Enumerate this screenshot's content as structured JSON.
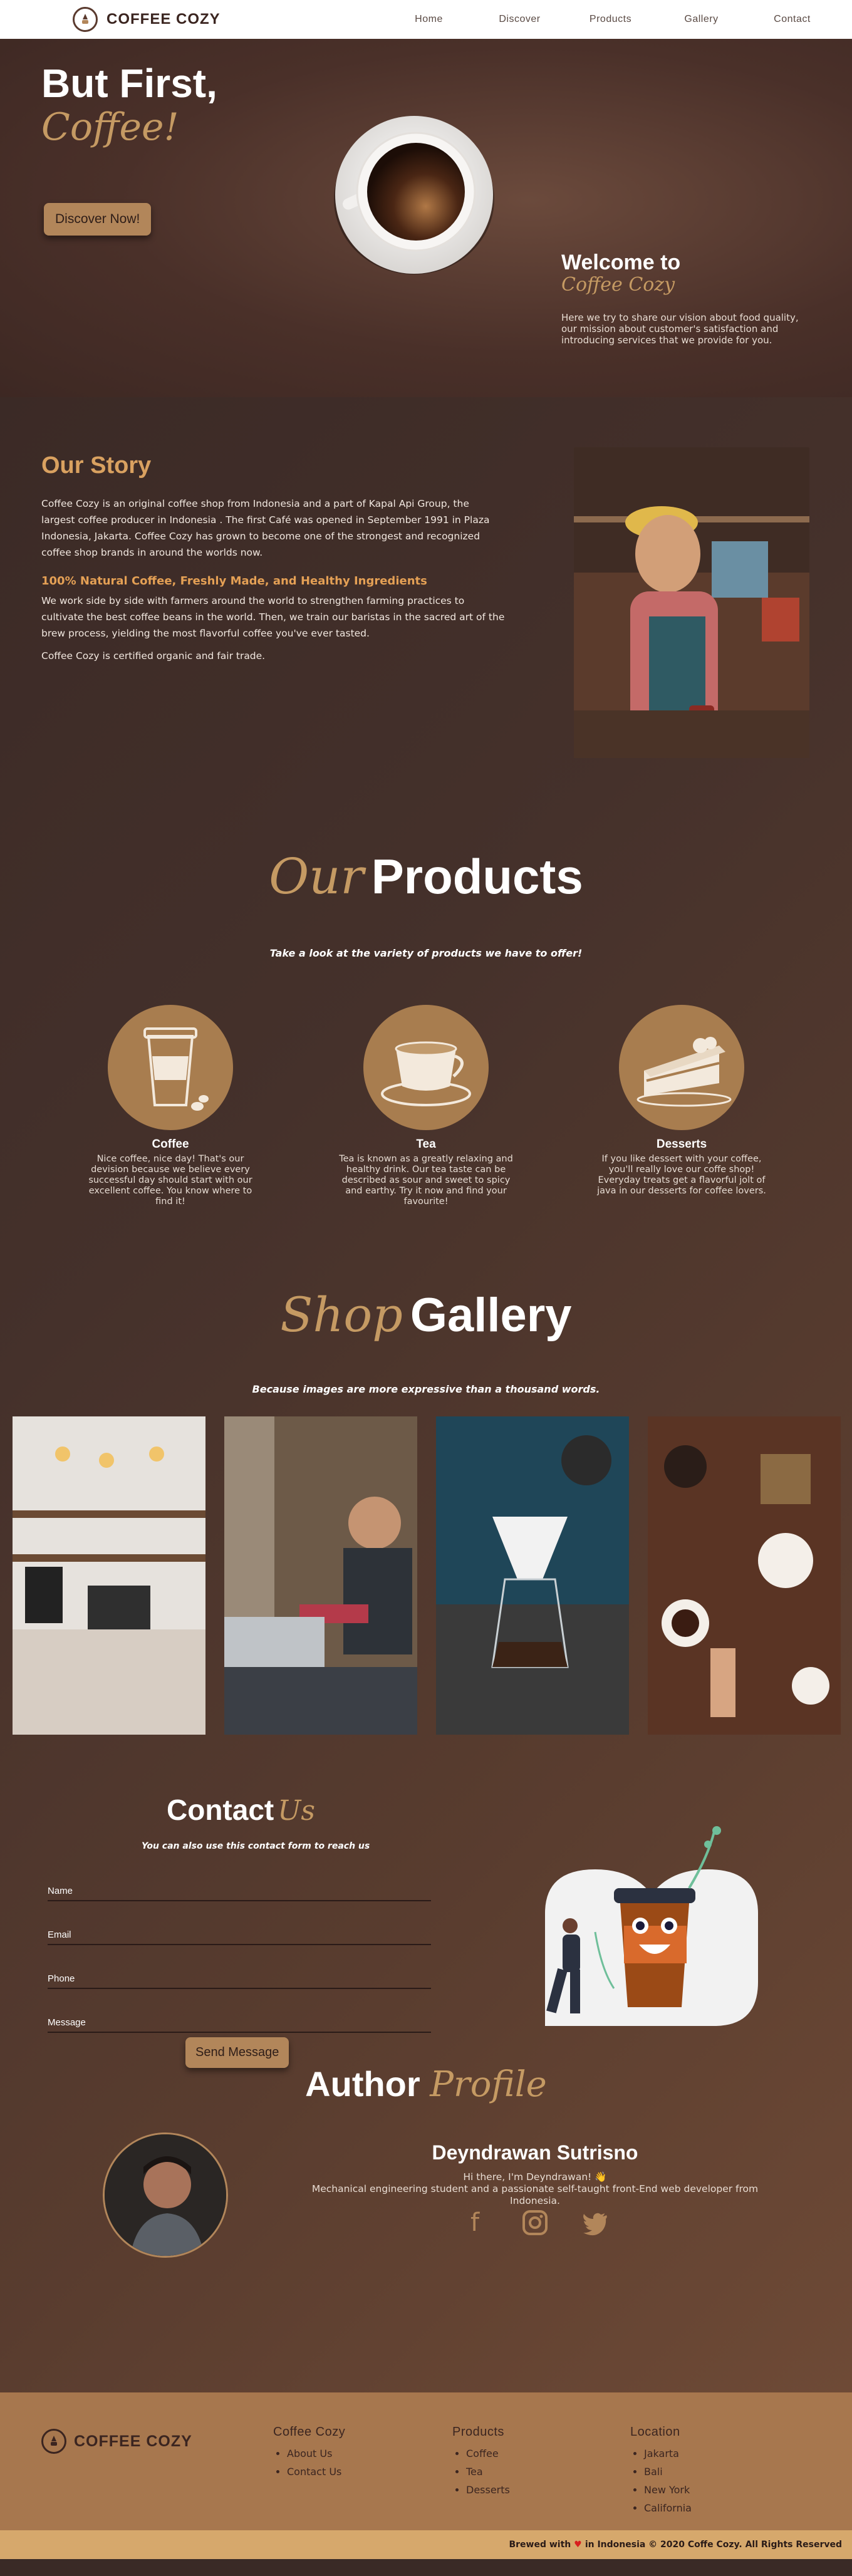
{
  "nav": {
    "brand": "COFFEE COZY",
    "items": [
      "Home",
      "Discover",
      "Products",
      "Gallery",
      "Contact"
    ]
  },
  "hero": {
    "title": "But First,",
    "script_word": "Coffee!",
    "cta": "Discover Now!",
    "welcome_title": "Welcome to",
    "welcome_script": "Coffee Cozy",
    "welcome_text": "Here we try to share our vision about food quality, our mission about customer's satisfaction and introducing services that we provide for you."
  },
  "story": {
    "title": "Our Story",
    "p1": "Coffee Cozy is an original coffee shop from Indonesia and a part of Kapal Api Group, the largest coffee producer in Indonesia . The first Café was opened in September 1991 in Plaza Indonesia, Jakarta. Coffee Cozy has grown to become one of the strongest and recognized coffee shop brands in around the worlds now.",
    "subtitle": "100% Natural Coffee, Freshly Made, and Healthy Ingredients",
    "p2": "We work side by side with farmers around the world to strengthen farming practices to cultivate the best coffee beans in the world. Then, we train our baristas in the sacred art of the brew process, yielding the most flavorful coffee you've ever tasted.",
    "p3": "Coffee Cozy is certified organic and fair trade."
  },
  "products": {
    "title_script": "Our",
    "title": "Products",
    "subtitle": "Take a look at the variety of products we have to offer!",
    "items": [
      {
        "name": "Coffee",
        "text": "Nice coffee, nice day! That's our devision because we believe every successful day should start with our excellent coffee. You know where to find it!"
      },
      {
        "name": "Tea",
        "text": "Tea is known as a greatly relaxing and healthy drink. Our tea taste can be described as sour and sweet to spicy and earthy. Try it now and find your favourite!"
      },
      {
        "name": "Desserts",
        "text": "If you like dessert with your coffee, you'll really love our coffe shop! Everyday treats get a flavorful jolt of java in our desserts for coffee lovers."
      }
    ]
  },
  "gallery": {
    "title_script": "Shop",
    "title": "Gallery",
    "subtitle": "Because images are more expressive than a thousand words."
  },
  "contact": {
    "title": "Contact",
    "title_script": "Us",
    "subtitle": "You can also use this contact form to reach us",
    "fields": [
      "Name",
      "Email",
      "Phone",
      "Message"
    ],
    "submit": "Send Message"
  },
  "author": {
    "title": "Author",
    "title_script": "Profile",
    "name": "Deyndrawan Sutrisno",
    "line1": "Hi there, I'm Deyndrawan! 👋",
    "line2": "Mechanical engineering student and a passionate self-taught front-End web developer from Indonesia."
  },
  "footer": {
    "brand": "COFFEE COZY",
    "cols": [
      {
        "title": "Coffee Cozy",
        "items": [
          "About Us",
          "Contact Us"
        ]
      },
      {
        "title": "Products",
        "items": [
          "Coffee",
          "Tea",
          "Desserts"
        ]
      },
      {
        "title": "Location",
        "items": [
          "Jakarta",
          "Bali",
          "New York",
          "California"
        ]
      }
    ],
    "copy_left": "Brewed with",
    "copy_right": "in Indonesia © 2020 Coffe Cozy. All Rights Reserved"
  }
}
